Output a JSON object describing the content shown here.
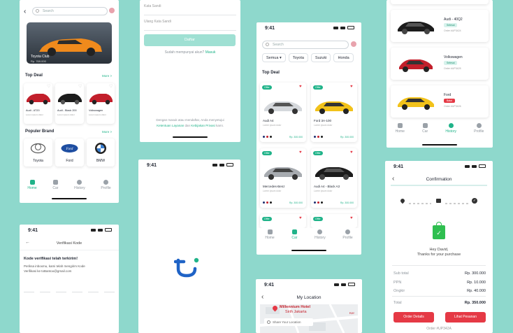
{
  "colors": {
    "background": "#8ed8cc",
    "accent": "#20b389",
    "danger": "#e53945"
  },
  "screen1": {
    "search_placeholder": "Search",
    "hero_name": "Toyota Club",
    "hero_price": "Rp. 769.000",
    "top_deal": "Top Deal",
    "more": "More >",
    "deals": [
      {
        "name": "Audi - AT20",
        "sub": "Lorem ipsum dolor"
      },
      {
        "name": "Audi - Black 200",
        "sub": "Lorem ipsum dolor"
      },
      {
        "name": "Volkswagen",
        "sub": "Lorem ipsum dolor"
      }
    ],
    "popular_brand": "Populer Brand",
    "brands": [
      "Toyota",
      "Ford",
      "BMW"
    ],
    "nav": [
      "Home",
      "Car",
      "History",
      "Profile"
    ]
  },
  "screen2": {
    "password": "Kata Sandi",
    "repeat_password": "Ulang Kata Sandi",
    "button": "Daftar",
    "has_account": "Sudah mempunyai akun?",
    "login": "Masuk",
    "terms_1": "Dengan masuk atau mendaftar, Anda menyetujui",
    "terms_link1": "Ketentuan Layanan",
    "terms_and": "dan",
    "terms_link2": "Kebijakan Privasi",
    "terms_end": "kami."
  },
  "screen3": {
    "time": "9:41"
  },
  "screen4": {
    "time": "9:41",
    "search_placeholder": "Search",
    "filters": [
      "Semua",
      "Toyota",
      "Suzuki",
      "Honda"
    ],
    "top_deal": "Top Deal",
    "offer": "Offer",
    "cars": [
      {
        "name": "Audi A4",
        "sub": "Lorem ipsum dolor",
        "price": "Rp. 300.000"
      },
      {
        "name": "Ford 3A-100",
        "sub": "Lorem ipsum dolor",
        "price": "Rp. 300.000"
      },
      {
        "name": "Mercedes-Benz",
        "sub": "Lorem ipsum dolor",
        "price": "Rp. 300.000"
      },
      {
        "name": "Audi A4 - Black A3",
        "sub": "Lorem ipsum dolor",
        "price": "Rp. 300.000"
      }
    ],
    "nav": [
      "Home",
      "Car",
      "History",
      "Profile"
    ]
  },
  "screen5": {
    "history": [
      {
        "name": "Audi - 40Q2",
        "status": "Selesai",
        "order": "Order #UP3424"
      },
      {
        "name": "Volkswagen",
        "status": "Selesai",
        "order": "Order #UP3425"
      },
      {
        "name": "Ford",
        "status": "Batal",
        "order": "Order #UP3426"
      }
    ],
    "nav": [
      "Home",
      "Car",
      "History",
      "Profile"
    ]
  },
  "screen6": {
    "time": "9:41",
    "title": "Verifikasi Kode",
    "sent": "Kode verifikasi telah terkirim!",
    "desc1": "Periksa inboxmu, kami telah mengirim Kode",
    "desc2": "Verifikasi ke toBantoo@gmail.com"
  },
  "screen7": {
    "time": "9:41",
    "title": "My Location",
    "pin": "Millennium Hotel",
    "pin_sub": "Sirih Jakarta",
    "share": "Share Your Location",
    "ker": "Ker"
  },
  "screen8": {
    "time": "9:41",
    "title": "Confirmation",
    "thanks1": "Hey David,",
    "thanks2": "Thanks for your purchase",
    "rows": [
      {
        "label": "Sub total",
        "value": "Rp. 300.000"
      },
      {
        "label": "PPN",
        "value": "Rp. 10.000"
      },
      {
        "label": "Ongkir",
        "value": "Rp. 40.000"
      }
    ],
    "total_label": "Total",
    "total_value": "Rp. 350.000",
    "order_details": "Order Details",
    "see_order": "Lihat Pesanan",
    "order_id": "Order #UP342A"
  }
}
